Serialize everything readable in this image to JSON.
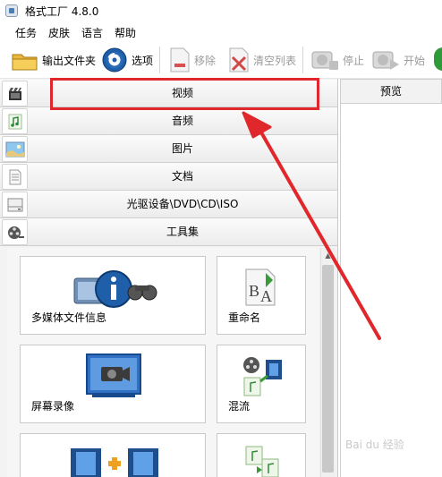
{
  "window": {
    "title": "格式工厂 4.8.0"
  },
  "menu": [
    {
      "name": "menu-task",
      "label": "任务"
    },
    {
      "name": "menu-skin",
      "label": "皮肤"
    },
    {
      "name": "menu-language",
      "label": "语言"
    },
    {
      "name": "menu-help",
      "label": "帮助"
    }
  ],
  "toolbar": {
    "output_folder": "输出文件夹",
    "options": "选项",
    "remove": "移除",
    "clear_list": "清空列表",
    "stop": "停止",
    "start": "开始"
  },
  "categories": [
    {
      "label": "视频",
      "icon": "video-clapper-icon"
    },
    {
      "label": "音频",
      "icon": "audio-note-icon"
    },
    {
      "label": "图片",
      "icon": "picture-icon"
    },
    {
      "label": "文档",
      "icon": "document-icon"
    },
    {
      "label": "光驱设备\\DVD\\CD\\ISO",
      "icon": "disc-drive-icon"
    },
    {
      "label": "工具集",
      "icon": "film-reel-icon"
    }
  ],
  "preview": {
    "header": "预览"
  },
  "tools": [
    {
      "label": "多媒体文件信息",
      "icon": "media-info-icon"
    },
    {
      "label": "重命名",
      "icon": "rename-icon"
    },
    {
      "label": "屏幕录像",
      "icon": "screen-record-icon"
    },
    {
      "label": "混流",
      "icon": "mux-icon"
    },
    {
      "label": "",
      "icon": "video-join-icon"
    },
    {
      "label": "",
      "icon": "audio-join-icon"
    }
  ],
  "colors": {
    "annotation": "#e0282c",
    "accent": "#2a6bb8"
  },
  "watermark": "Bai du 经验"
}
